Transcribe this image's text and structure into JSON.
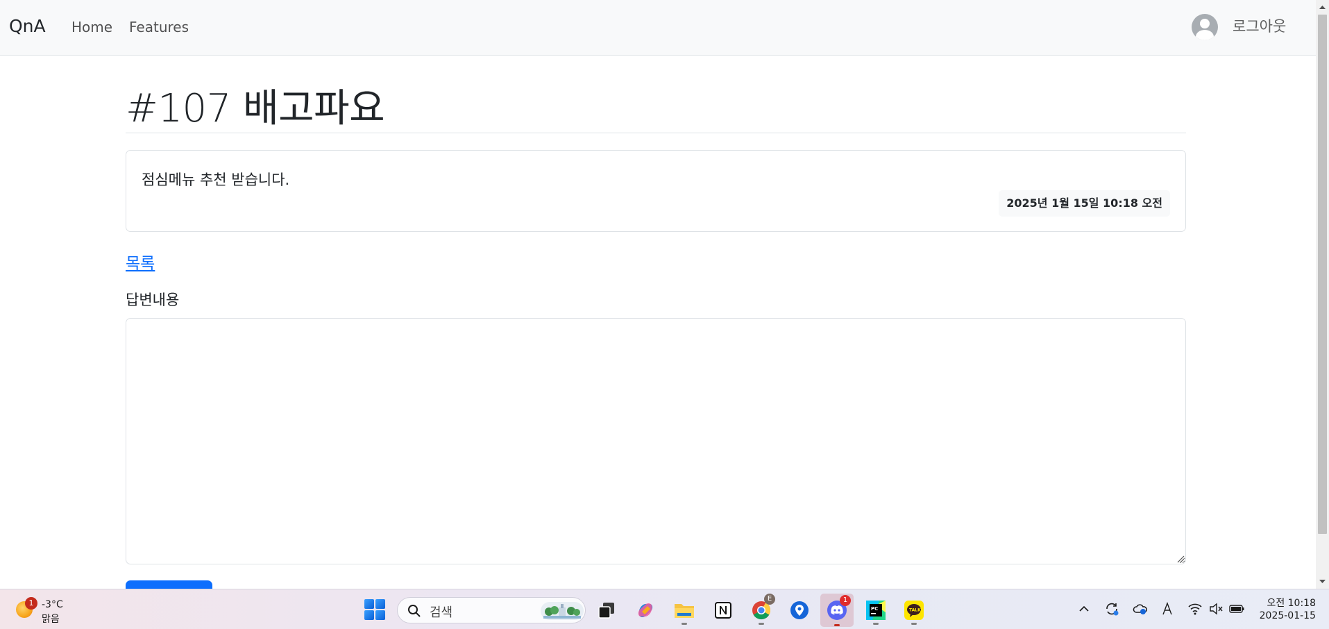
{
  "navbar": {
    "brand": "QnA",
    "links": [
      "Home",
      "Features"
    ],
    "logout": "로그아웃"
  },
  "question": {
    "title": "#107 배고파요",
    "content": "점심메뉴 추천 받습니다.",
    "date": "2025년 1월 15일 10:18 오전"
  },
  "actions": {
    "list_link": "목록"
  },
  "answer": {
    "label": "답변내용",
    "value": ""
  },
  "taskbar": {
    "weather": {
      "temp": "-3°C",
      "condition": "맑음",
      "badge": "1"
    },
    "search_placeholder": "검색",
    "chrome_badge": "E",
    "discord_badge": "1",
    "clock": {
      "time": "오전 10:18",
      "date": "2025-01-15"
    },
    "apps": [
      "task-view",
      "copilot",
      "file-explorer",
      "notion",
      "chrome",
      "location-app",
      "discord",
      "pycharm",
      "kakaotalk"
    ]
  },
  "colors": {
    "primary": "#0d6efd",
    "navbar_bg": "#f8f9fa",
    "border": "#dee2e6"
  }
}
